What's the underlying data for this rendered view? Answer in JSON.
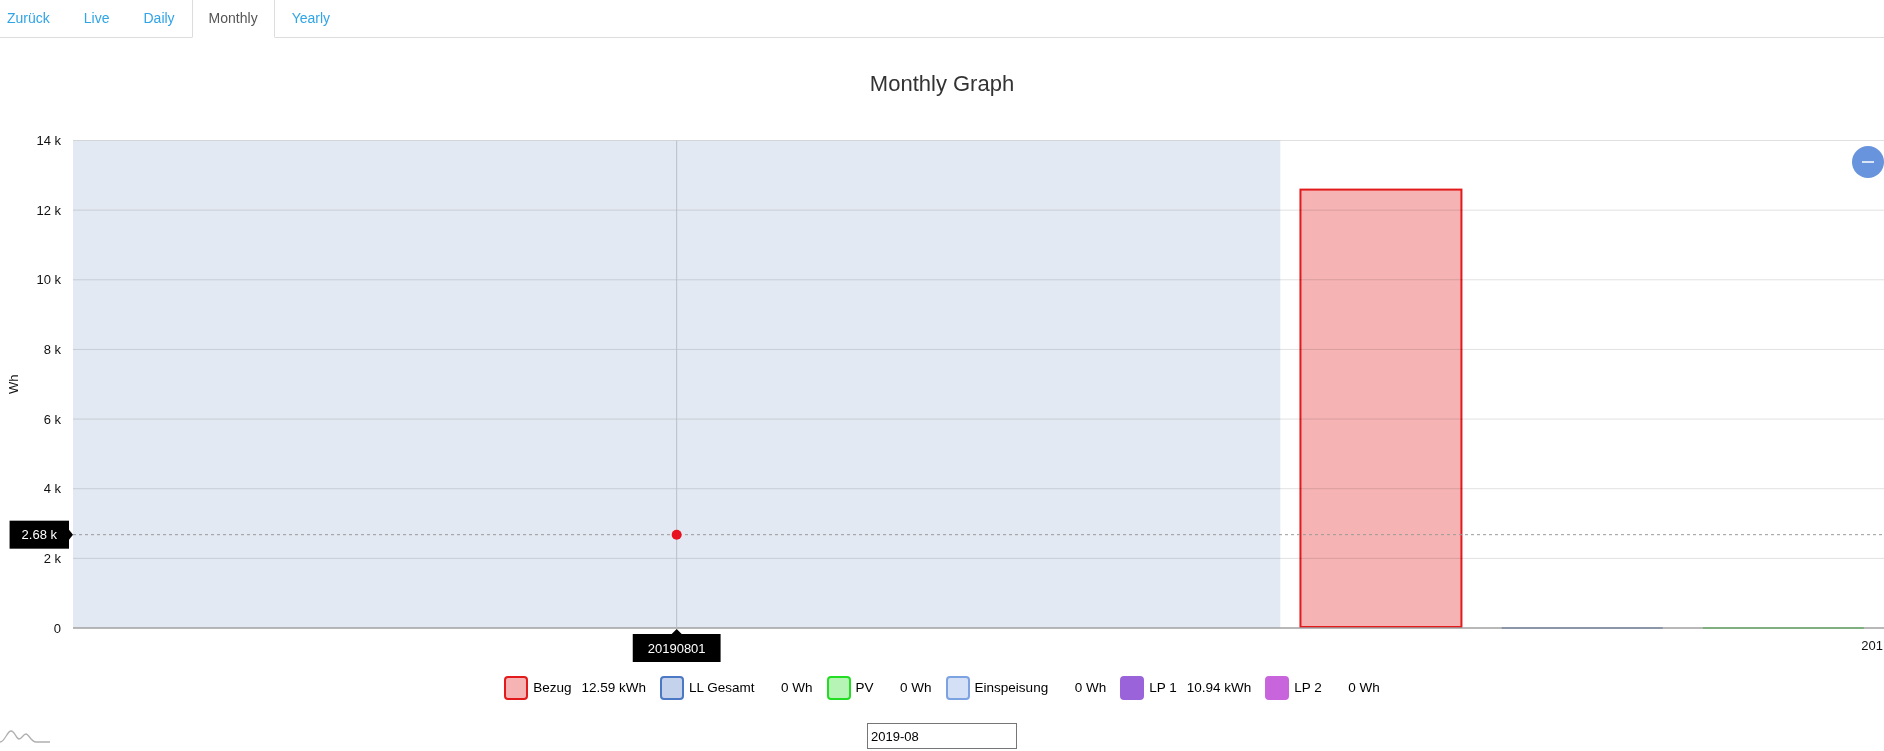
{
  "tabs": [
    {
      "label": "Zurück",
      "selected": false
    },
    {
      "label": "Live",
      "selected": false
    },
    {
      "label": "Daily",
      "selected": false
    },
    {
      "label": "Monthly",
      "selected": true
    },
    {
      "label": "Yearly",
      "selected": false
    }
  ],
  "chart": {
    "chart_data": {
      "type": "bar",
      "title": "Monthly Graph",
      "ylabel": "Wh",
      "categories": [
        "20190801",
        "201"
      ],
      "ylim": [
        0,
        14000
      ],
      "yticks": [
        0,
        {
          "value": 2000,
          "label": "2 k"
        },
        {
          "value": 4000,
          "label": "4 k"
        },
        {
          "value": 6000,
          "label": "6 k"
        },
        {
          "value": 8000,
          "label": "8 k"
        },
        {
          "value": 10000,
          "label": "10 k"
        },
        {
          "value": 12000,
          "label": "12 k"
        },
        {
          "value": 14000,
          "label": "14 k"
        }
      ],
      "grid": true,
      "series": [
        {
          "name": "Bezug",
          "color": "#e31a1c",
          "values": [
            null,
            12590
          ]
        },
        {
          "name": "LL Gesamt",
          "color": "#4c78c4",
          "values": [
            null,
            0
          ]
        },
        {
          "name": "PV",
          "color": "#22dd22",
          "values": [
            null,
            0
          ]
        },
        {
          "name": "Einspeisung",
          "color": "#7da2e0",
          "values": [
            null,
            null
          ]
        },
        {
          "name": "LP 1",
          "color": "#9b63d9",
          "values": [
            null,
            null
          ]
        },
        {
          "name": "LP 2",
          "color": "#c865dc",
          "values": [
            null,
            null
          ]
        }
      ],
      "ref_lines": [
        {
          "axis": "x",
          "value": "20190801"
        },
        {
          "axis": "y",
          "value": 2680,
          "label": "2.68 k"
        }
      ],
      "bands": [
        {
          "axis": "x",
          "from": "20190801",
          "to": "20190801"
        }
      ]
    },
    "legend": [
      {
        "value": "12.59 kWh",
        "filled": false
      },
      {
        "value": "0 Wh",
        "filled": false
      },
      {
        "value": "0 Wh",
        "filled": false
      },
      {
        "value": "0 Wh",
        "filled": false
      },
      {
        "value": "10.94 kWh",
        "filled": true
      },
      {
        "value": "0 Wh",
        "filled": true
      }
    ]
  },
  "month_input": {
    "value": "2019-08"
  }
}
